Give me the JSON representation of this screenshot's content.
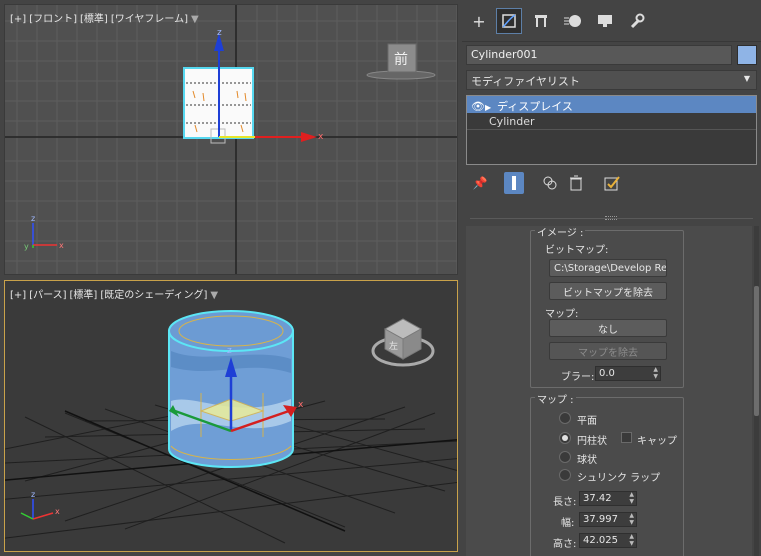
{
  "viewports": {
    "top": {
      "label_parts": [
        "[+]",
        "[フロント]",
        "[標準]",
        "[ワイヤフレーム]"
      ],
      "viewcube_face": "前",
      "axis_x": "x",
      "axis_z": "z"
    },
    "perspective": {
      "label_parts": [
        "[+]",
        "[パース]",
        "[標準]",
        "[既定のシェーディング]"
      ],
      "viewcube_face": "左",
      "axis_x": "x",
      "axis_z": "z"
    }
  },
  "panel": {
    "tabs": [
      "create-tab",
      "modify-tab",
      "hierarchy-tab",
      "motion-tab",
      "display-tab",
      "utilities-tab"
    ],
    "object_name": "Cylinder001",
    "object_color": "#8fb4e6",
    "modifier_list_label": "モディファイヤリスト",
    "stack": {
      "selected_modifier": "ディスプレイス",
      "base_object": "Cylinder"
    },
    "image_group": {
      "title": "イメージ :",
      "bitmap_label": "ビットマップ:",
      "bitmap_path": "C:\\Storage\\Develop Rep",
      "remove_bitmap_label": "ビットマップを除去",
      "map_label": "マップ:",
      "map_value": "なし",
      "remove_map_label": "マップを除去",
      "blur_label": "ブラー:",
      "blur_value": "0.0"
    },
    "map_group": {
      "title": "マップ :",
      "option_planar": "平面",
      "option_cylindrical": "円柱状",
      "option_cap": "キャップ",
      "option_spherical": "球状",
      "option_shrinkwrap": "シュリンク ラップ",
      "length_label": "長さ:",
      "length_value": "37.42",
      "width_label": "幅:",
      "width_value": "37.997",
      "height_label": "高さ:",
      "height_value": "42.025"
    }
  }
}
